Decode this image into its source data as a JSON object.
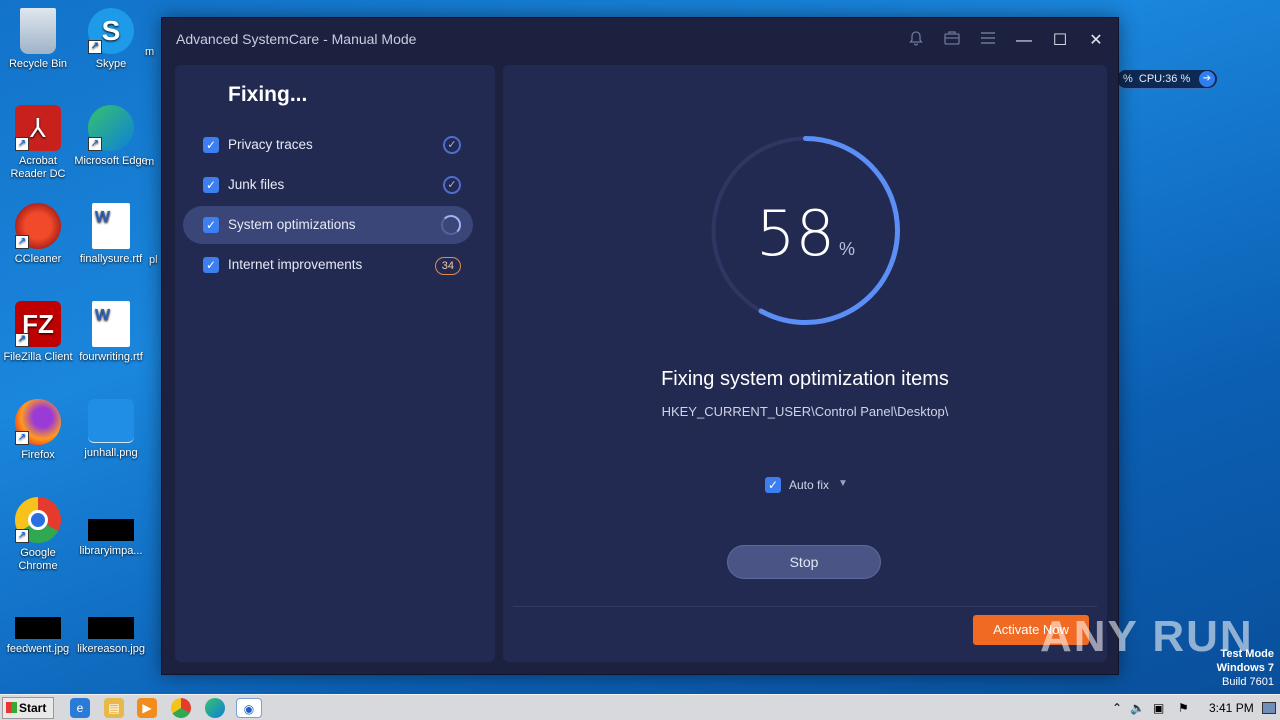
{
  "desktop": {
    "icons": [
      {
        "label": "Recycle Bin"
      },
      {
        "label": "Skype"
      },
      {
        "label": "Acrobat Reader DC"
      },
      {
        "label": "Microsoft Edge"
      },
      {
        "label": "CCleaner"
      },
      {
        "label": "finallysure.rtf"
      },
      {
        "label": "FileZilla Client"
      },
      {
        "label": "fourwriting.rtf"
      },
      {
        "label": "Firefox"
      },
      {
        "label": "junhall.png"
      },
      {
        "label": "Google Chrome"
      },
      {
        "label": "libraryimpa..."
      },
      {
        "label": "feedwent.jpg"
      },
      {
        "label": "likereason.jpg"
      }
    ],
    "partial_labels": {
      "skype_col": "m",
      "edge_col": "m",
      "ccleaner_col": "pl"
    }
  },
  "window": {
    "title": "Advanced SystemCare - Manual Mode",
    "controls": {
      "minimize": "—",
      "maximize": "☐",
      "close": "✕"
    }
  },
  "left_panel": {
    "heading": "Fixing...",
    "tasks": [
      {
        "label": "Privacy traces",
        "state": "done"
      },
      {
        "label": "Junk files",
        "state": "done"
      },
      {
        "label": "System optimizations",
        "state": "in-progress"
      },
      {
        "label": "Internet improvements",
        "state": "pending",
        "count": "34"
      }
    ]
  },
  "progress": {
    "value": "58",
    "unit": "%",
    "fraction": 0.58
  },
  "status": {
    "title": "Fixing system optimization items",
    "path": "HKEY_CURRENT_USER\\Control Panel\\Desktop\\"
  },
  "autofix": {
    "label": "Auto fix",
    "checked": true
  },
  "buttons": {
    "stop": "Stop",
    "activate": "Activate Now"
  },
  "cpu_widget": {
    "prefix": "%",
    "label": "CPU:36 %"
  },
  "watermark": {
    "text": "ANY RUN"
  },
  "os_info": {
    "line1": "Test Mode",
    "line2": "Windows 7",
    "line3": "Build 7601"
  },
  "taskbar": {
    "start": "Start",
    "clock": "3:41 PM"
  },
  "colors": {
    "accent": "#3d7ff0",
    "activate": "#f06a24",
    "panel": "#232a52",
    "ring": "#5b8ff5"
  }
}
